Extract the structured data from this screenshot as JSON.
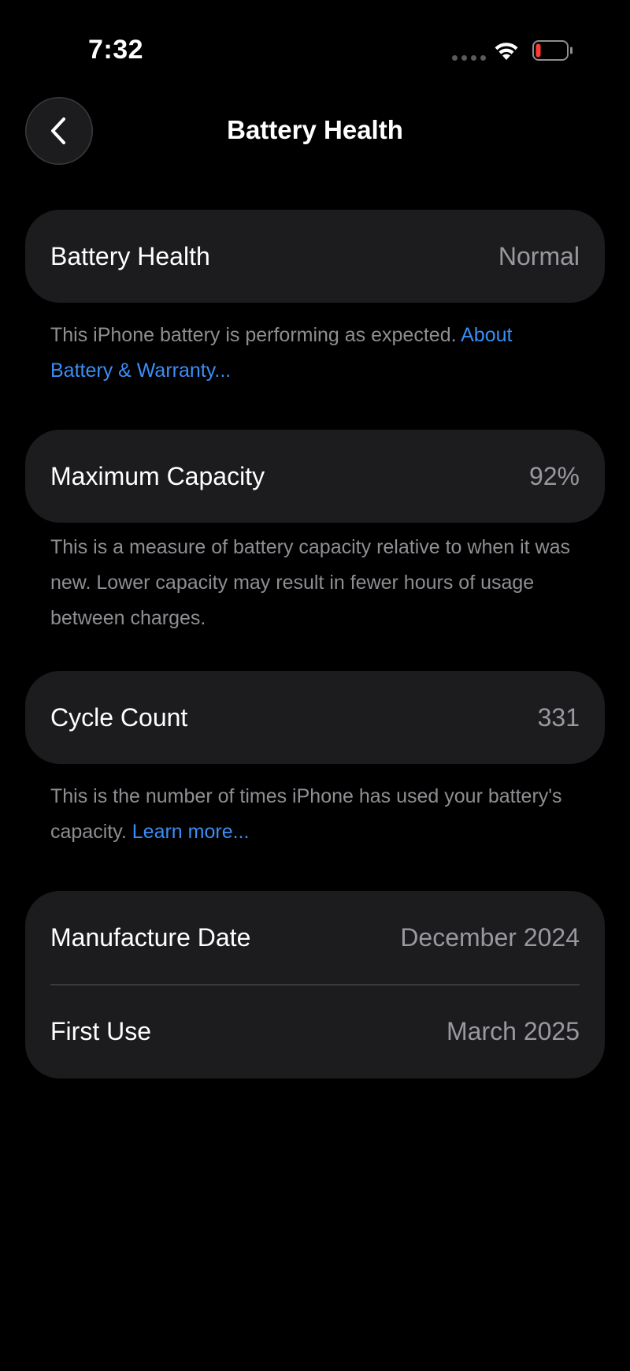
{
  "status_bar": {
    "time": "7:32",
    "icons": [
      "signal-dots-icon",
      "wifi-icon",
      "battery-low-icon"
    ],
    "battery_level": 0.12
  },
  "nav": {
    "title": "Battery Health",
    "back_icon": "chevron-left-icon"
  },
  "sections": {
    "health": {
      "label": "Battery Health",
      "value": "Normal",
      "footnote": "This iPhone battery is performing as expected.",
      "link": "About Battery & Warranty..."
    },
    "capacity": {
      "label": "Maximum Capacity",
      "value": "92%",
      "footnote": "This is a measure of battery capacity relative to when it was new. Lower capacity may result in fewer hours of usage between charges."
    },
    "cycle": {
      "label": "Cycle Count",
      "value": "331",
      "footnote": "This is the number of times iPhone has used your battery's capacity.",
      "link": "Learn more..."
    },
    "dates": {
      "manufacture_label": "Manufacture Date",
      "manufacture_value": "December 2024",
      "first_use_label": "First Use",
      "first_use_value": "March 2025"
    }
  },
  "colors": {
    "background": "#000000",
    "card": "#1c1c1e",
    "secondary_text": "#98989f",
    "link": "#3a8ef6",
    "battery_low": "#ff3b30"
  }
}
